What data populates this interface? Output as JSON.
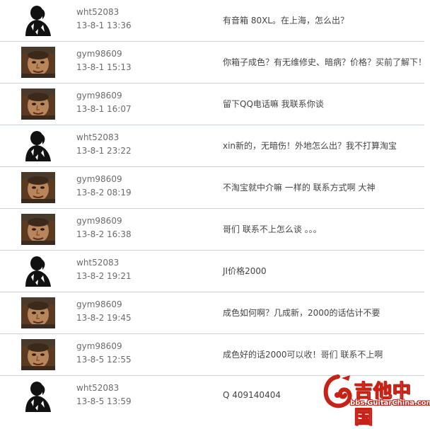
{
  "posts": [
    {
      "user": "wht52083",
      "time": "13-8-1 13:36",
      "message": "有音箱 80XL。在上海，怎么出？",
      "avatar": "silhouette-avatar"
    },
    {
      "user": "gym98609",
      "time": "13-8-1 15:13",
      "message": "你箱子成色？有无维修史、暗病？价格？买前了解下！",
      "avatar": "face-avatar"
    },
    {
      "user": "gym98609",
      "time": "13-8-1 16:07",
      "message": "留下QQ电话嘛 我联系你谈",
      "avatar": "face-avatar"
    },
    {
      "user": "wht52083",
      "time": "13-8-1 23:22",
      "message": "xin新的，无暗伤！外地怎么出？我不打算淘宝",
      "avatar": "silhouette-avatar"
    },
    {
      "user": "gym98609",
      "time": "13-8-2 08:19",
      "message": "不淘宝就中介嘛 一样的 联系方式啊 大神",
      "avatar": "face-avatar"
    },
    {
      "user": "gym98609",
      "time": "13-8-2 16:38",
      "message": "哥们 联系不上怎么谈 。。。",
      "avatar": "face-avatar"
    },
    {
      "user": "wht52083",
      "time": "13-8-2 19:21",
      "message": "JI价格2000",
      "avatar": "silhouette-avatar"
    },
    {
      "user": "gym98609",
      "time": "13-8-2 19:45",
      "message": "成色如何啊？几成新，2000的话估计不要",
      "avatar": "face-avatar"
    },
    {
      "user": "gym98609",
      "time": "13-8-5 12:55",
      "message": "成色好的话2000可以收！哥们 联系不上啊",
      "avatar": "face-avatar"
    },
    {
      "user": "wht52083",
      "time": "13-8-5 13:59",
      "message": "Q 409140404",
      "avatar": "silhouette-avatar"
    }
  ],
  "watermark": {
    "name": "吉他中国",
    "url": "bbs.GuitarChina.com",
    "color": "#c62216"
  }
}
